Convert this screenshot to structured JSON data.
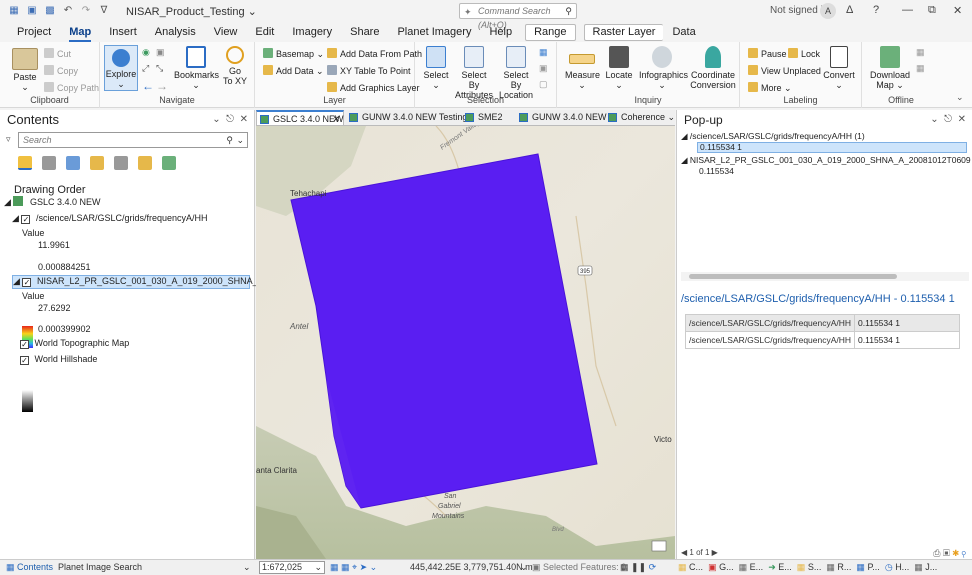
{
  "app": {
    "title": "NISAR_Product_Testing ⌄",
    "command_search_placeholder": "Command Search (Alt+Q)",
    "signin": "Not signed in",
    "avatar": "A",
    "help": "?",
    "minimize": "—",
    "restore": "⧉",
    "close": "✕",
    "bell": "Δ"
  },
  "menu": {
    "items": [
      "Project",
      "Map",
      "Insert",
      "Analysis",
      "View",
      "Edit",
      "Imagery",
      "Share",
      "Planet Imagery",
      "Help"
    ],
    "contextual": [
      "Range",
      "Raster Layer",
      "Data"
    ]
  },
  "ribbon": {
    "clipboard": {
      "paste": "Paste",
      "cut": "Cut",
      "copy": "Copy",
      "copy_path": "Copy Path",
      "label": "Clipboard"
    },
    "navigate": {
      "explore": "Explore",
      "bookmarks": "Bookmarks",
      "goto": "Go\nTo XY",
      "label": "Navigate"
    },
    "layer": {
      "basemap": "Basemap ⌄",
      "add_data": "Add Data ⌄",
      "add_data_path": "Add Data From Path",
      "xy_table": "XY Table To Point",
      "add_graphics": "Add Graphics Layer",
      "label": "Layer"
    },
    "selection": {
      "select": "Select",
      "select_attr": "Select By\nAttributes",
      "select_loc": "Select By\nLocation",
      "label": "Selection"
    },
    "inquiry": {
      "measure": "Measure",
      "locate": "Locate",
      "infographics": "Infographics",
      "coord": "Coordinate\nConversion",
      "label": "Inquiry"
    },
    "labeling": {
      "pause": "Pause",
      "lock": "Lock",
      "view_unplaced": "View Unplaced",
      "more": "More ⌄",
      "convert": "Convert",
      "label": "Labeling"
    },
    "offline": {
      "download": "Download\nMap ⌄",
      "label": "Offline"
    }
  },
  "contents": {
    "title": "Contents",
    "search_placeholder": "Search",
    "drawing_order": "Drawing Order",
    "map_name": "GSLC 3.4.0 NEW",
    "layer1": "/science/LSAR/GSLC/grids/frequencyA/HH",
    "layer1_value": "Value",
    "layer1_max": "11.9961",
    "layer1_min": "0.000884251",
    "layer2": "NISAR_L2_PR_GSLC_001_030_A_019_2000_SHNA_A_20081012T...",
    "layer2_value": "Value",
    "layer2_max": "27.6292",
    "layer2_min": "0.000399902",
    "layer3": "World Topographic Map",
    "layer4": "World Hillshade"
  },
  "map_tabs": [
    "GSLC 3.4.0 NEW",
    "GUNW 3.4.0 NEW Testing",
    "SME2",
    "GUNW 3.4.0 NEW",
    "Coherence"
  ],
  "map_labels": {
    "tehachapi": "Tehachapi",
    "antelope": "Antel",
    "victo": "Victo",
    "santa_clarita": "anta Clarita",
    "hwy": "395",
    "fremont": "Fremont Valley",
    "san_gabriel": "San\nGabriel\nMountains",
    "bottom": "Blvd"
  },
  "popup": {
    "title": "Pop-up",
    "tree_root": "/science/LSAR/GSLC/grids/frequencyA/HH (1)",
    "tree_root_value": "0.115534 1",
    "tree2": "NISAR_L2_PR_GSLC_001_030_A_019_2000_SHNA_A_20081012T060910_20081012T06",
    "tree2_value": "0.115534",
    "header": "/science/LSAR/GSLC/grids/frequencyA/HH - 0.115534 1",
    "rows": [
      {
        "k": "/science/LSAR/GSLC/grids/frequencyA/HH",
        "v": "0.115534 1"
      },
      {
        "k": "/science/LSAR/GSLC/grids/frequencyA/HH",
        "v": "0.115534 1"
      }
    ],
    "pager": "1 of 1"
  },
  "statusbar": {
    "tab_contents": "Contents",
    "tab_planet": "Planet Image Search",
    "scale": "1:672,025",
    "coords": "445,442.25E 3,779,751.40N m",
    "selected": "Selected Features: 0",
    "dock": [
      "C...",
      "G...",
      "E...",
      "E...",
      "S...",
      "R...",
      "P...",
      "H...",
      "J..."
    ]
  },
  "colors": {
    "accent": "#2b6cc4",
    "raster": "#5a1ef2"
  }
}
